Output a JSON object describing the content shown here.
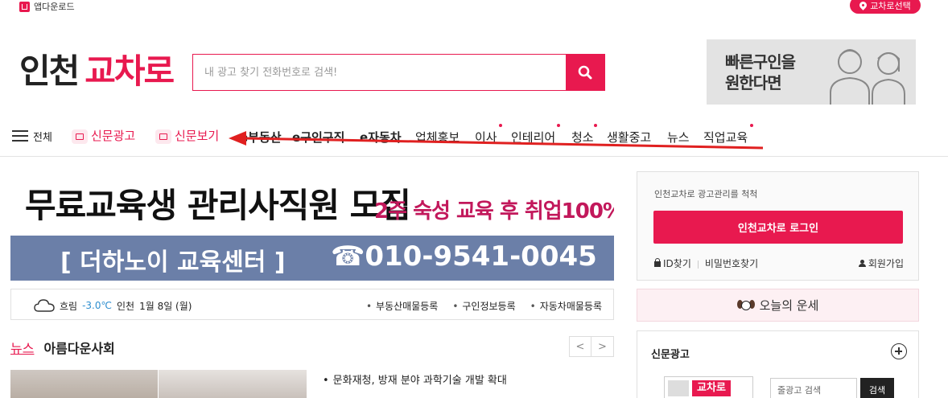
{
  "top": {
    "app_download": "앱다운로드",
    "region_select": "교차로선택"
  },
  "logo": {
    "part1": "인천",
    "part2": "교차로"
  },
  "search": {
    "placeholder": "내 광고 찾기 전화번호로 검색!"
  },
  "ad_banner": {
    "line1": "빠른구인을",
    "line2": "원한다면"
  },
  "nav": {
    "all": "전체",
    "newspaper_ad": "신문광고",
    "newspaper_view": "신문보기",
    "items": [
      "e부동산",
      "e구인구직",
      "e자동차",
      "업체홍보",
      "이사",
      "인테리어",
      "청소",
      "생활중고",
      "뉴스",
      "직업교육"
    ]
  },
  "main_banner": {
    "title": "무료교육생 관리사직원 모집",
    "subtitle": "2주 숙성 교육 후 취업100%",
    "center": "[ 더하노이 교육센터 ]",
    "phone": "☎010-9541-0045"
  },
  "weather": {
    "condition": "흐림",
    "temp": "-3.0℃",
    "location": "인천",
    "date": "1월 8일 (월)",
    "links": [
      "부동산매물등록",
      "구인정보등록",
      "자동차매물등록"
    ]
  },
  "news": {
    "tab_news": "뉴스",
    "tab_community": "아름다운사회",
    "prev": "<",
    "next": ">",
    "item1": "문화재청, 방재 분야 과학기술 개발 확대"
  },
  "login": {
    "message": "인천교차로 광고관리를 척척",
    "button": "인천교차로 로그인",
    "find_id": "ID찾기",
    "find_pw": "비밀번호찾기",
    "signup": "회원가입"
  },
  "fortune": {
    "label": "오늘의 운세"
  },
  "newspaper": {
    "title": "신문광고",
    "thumb_label": "교차로",
    "search_placeholder": "줄광고 검색",
    "search_button": "검색"
  },
  "colors": {
    "accent": "#e8194f",
    "banner_blue": "#6b7fa8"
  }
}
